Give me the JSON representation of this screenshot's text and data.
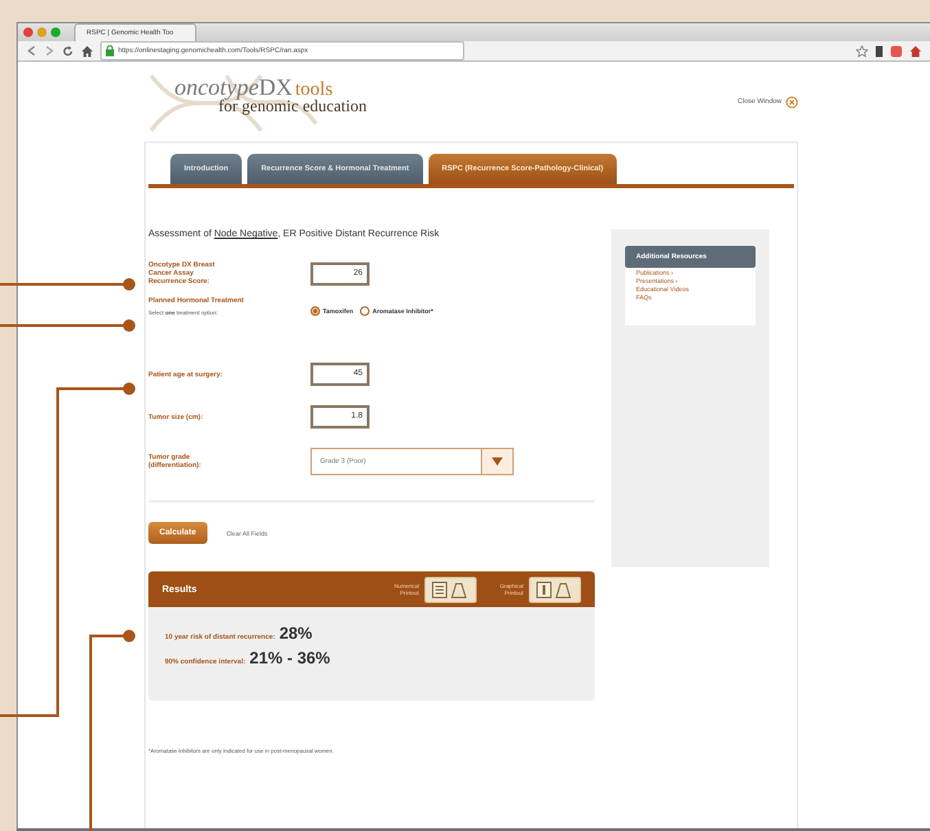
{
  "browser": {
    "tab_title": "RSPC | Genomic Health Too",
    "url": "https://onlinestaging.genomichealth.com/Tools/RSPC/ran.aspx"
  },
  "header": {
    "logo": {
      "brand": "oncotype",
      "mark": "DX",
      "product": "tools",
      "tagline": "for genomic education"
    },
    "close_link": "Close Window"
  },
  "tabs": [
    {
      "label": "Introduction",
      "selected": false
    },
    {
      "label": "Recurrence Score & Hormonal Treatment",
      "selected": false
    },
    {
      "label": "RSPC (Recurrence Score-Pathology-Clinical)",
      "selected": true
    }
  ],
  "form": {
    "heading": {
      "before": "Assessment of ",
      "link": "Node Negative",
      "after": ", ER Positive Distant Recurrence Risk"
    },
    "recurrence_score": {
      "label": "Oncotype DX Breast Cancer Assay Recurrence Score:",
      "value": "26"
    },
    "treatment": {
      "label": "Planned Hormonal Treatment",
      "hint": "Select **one** treatment option:",
      "options": [
        {
          "label": "Tamoxifen",
          "selected": true
        },
        {
          "label": "Aromatase Inhibitor*",
          "selected": false
        }
      ]
    },
    "age": {
      "label": "Patient age at surgery:",
      "value": "45"
    },
    "tumor_size": {
      "label": "Tumor size (cm):",
      "value": "1.8"
    },
    "tumor_grade": {
      "label": "Tumor grade (differentiation):",
      "value": "Grade 3 (Poor)"
    },
    "calculate_button": "Calculate",
    "clear_link": "Clear All Fields"
  },
  "results": {
    "title": "Results",
    "numerical_printout": "Numerical Printout",
    "graphical_printout": "Graphical Printout",
    "risk_label": "10 year risk of distant recurrence:",
    "risk_value": "28%",
    "interval_label": "90% confidence interval:",
    "interval_value": "21% - 36%"
  },
  "footnote": "*Aromatase inhibitors are only indicated for use in post-menopausal women.",
  "sidebar": {
    "title": "Additional Resources",
    "links": [
      "Publications ›",
      "Presentations ›",
      "Educational Videos",
      "FAQs"
    ]
  }
}
